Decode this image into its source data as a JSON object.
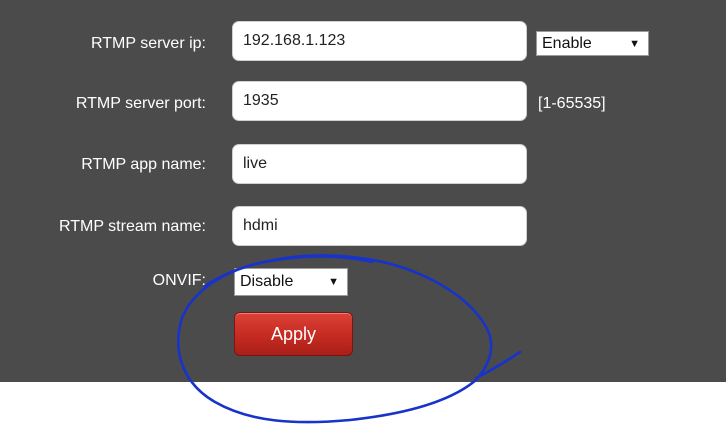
{
  "form": {
    "server_ip": {
      "label": "RTMP server ip:",
      "value": "192.168.1.123",
      "toggle": "Enable"
    },
    "server_port": {
      "label": "RTMP server port:",
      "value": "1935",
      "range_hint": "[1-65535]"
    },
    "app_name": {
      "label": "RTMP app name:",
      "value": "live"
    },
    "stream_name": {
      "label": "RTMP stream name:",
      "value": "hdmi"
    },
    "onvif": {
      "label": "ONVIF:",
      "value": "Disable"
    },
    "apply_label": "Apply"
  },
  "dropdown_caret": "▼",
  "colors": {
    "panel_background": "#4b4b4b",
    "apply_button": "#c52b22",
    "annotation_ink": "#1733c9"
  }
}
